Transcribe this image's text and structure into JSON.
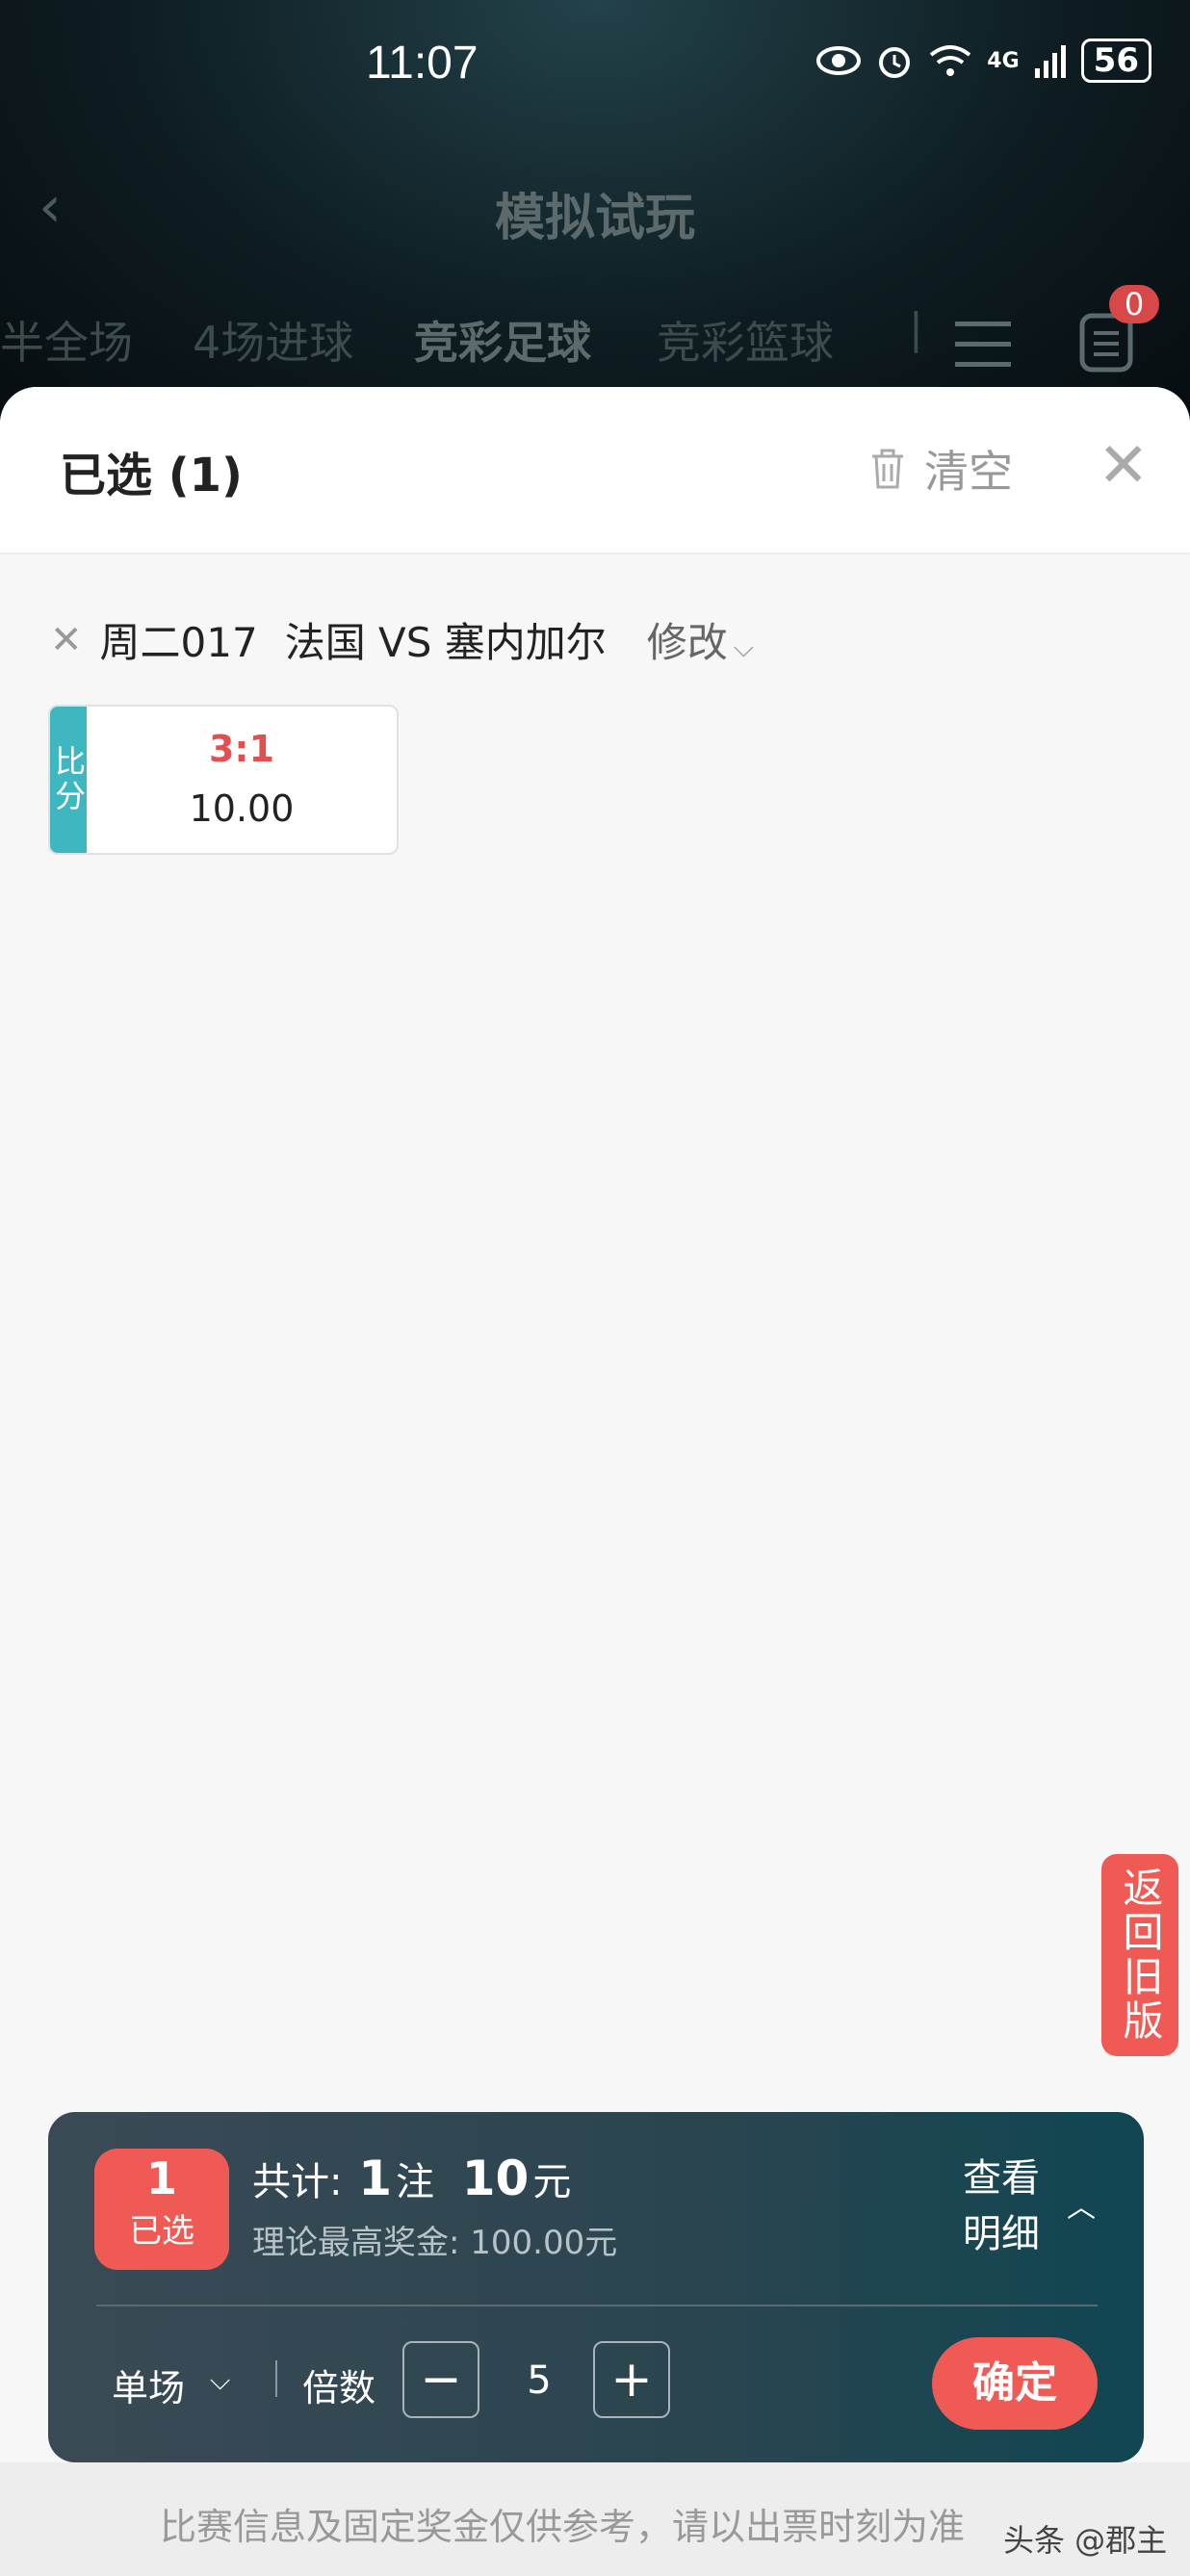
{
  "status_bar": {
    "time": "11:07",
    "network": "4G",
    "battery": "56"
  },
  "nav": {
    "title": "模拟试玩"
  },
  "tabs": [
    {
      "label": "半全场"
    },
    {
      "label": "4场进球"
    },
    {
      "label": "竞彩足球",
      "active": true
    },
    {
      "label": "竞彩篮球"
    }
  ],
  "cart_badge": "0",
  "sheet": {
    "title": "已选 (1)",
    "clear_label": "清空",
    "match": {
      "code": "周二017",
      "teams": "法国 VS 塞内加尔",
      "modify": "修改"
    },
    "selection": {
      "tag": "比分",
      "score": "3:1",
      "odds": "10.00"
    }
  },
  "old_version_label": "返回旧版",
  "bottom_bar": {
    "selected_count": "1",
    "selected_label": "已选",
    "total_prefix": "共计:",
    "bets": "1",
    "bets_unit": "注",
    "amount": "10",
    "amount_unit": "元",
    "max_prize": "理论最高奖金: 100.00元",
    "detail_line1": "查看",
    "detail_line2": "明细",
    "mode": "单场",
    "multiplier_label": "倍数",
    "multiplier": "5",
    "confirm": "确定"
  },
  "footer_notice": "比赛信息及固定奖金仅供参考，请以出票时刻为准",
  "watermark": "头条 @郡主",
  "colors": {
    "accent": "#f05a55",
    "tag": "#3fb7c0",
    "score": "#e05050"
  }
}
